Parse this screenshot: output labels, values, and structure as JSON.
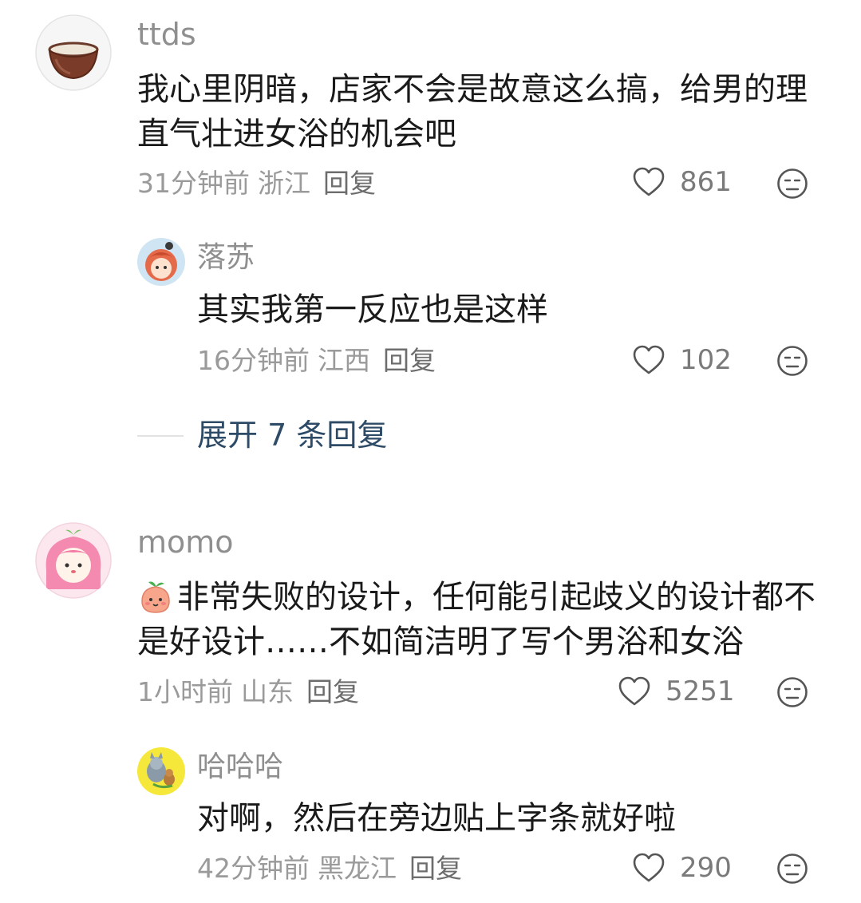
{
  "comments": [
    {
      "username": "ttds",
      "avatar_icon": "coconut-bowl-icon",
      "text": "我心里阴暗，店家不会是故意这么搞，给男的理直气壮进女浴的机会吧",
      "time": "31分钟前",
      "region": "浙江",
      "reply_label": "回复",
      "likes": "861"
    },
    {
      "username": "momo",
      "avatar_icon": "pink-hair-girl-icon",
      "emoji_icon": "peach-emoji-icon",
      "text": "非常失败的设计，任何能引起歧义的设计都不是好设计……不如简洁明了写个男浴和女浴",
      "time": "1小时前",
      "region": "山东",
      "reply_label": "回复",
      "likes": "5251"
    }
  ],
  "replies": [
    {
      "username": "落苏",
      "avatar_icon": "anime-girl-icon",
      "text": "其实我第一反应也是这样",
      "time": "16分钟前",
      "region": "江西",
      "reply_label": "回复",
      "likes": "102"
    },
    {
      "username": "哈哈哈",
      "avatar_icon": "cartoon-cat-mouse-icon",
      "text": "对啊，然后在旁边贴上字条就好啦",
      "time": "42分钟前",
      "region": "黑龙江",
      "reply_label": "回复",
      "likes": "290"
    }
  ],
  "expand": {
    "label": "展开 7 条回复"
  },
  "icons": {
    "like": "heart-outline-icon",
    "dislike": "unamused-face-icon"
  },
  "colors": {
    "expand_text": "#2d4a66",
    "meta": "#9a9a9a",
    "text": "#1a1a1a"
  }
}
